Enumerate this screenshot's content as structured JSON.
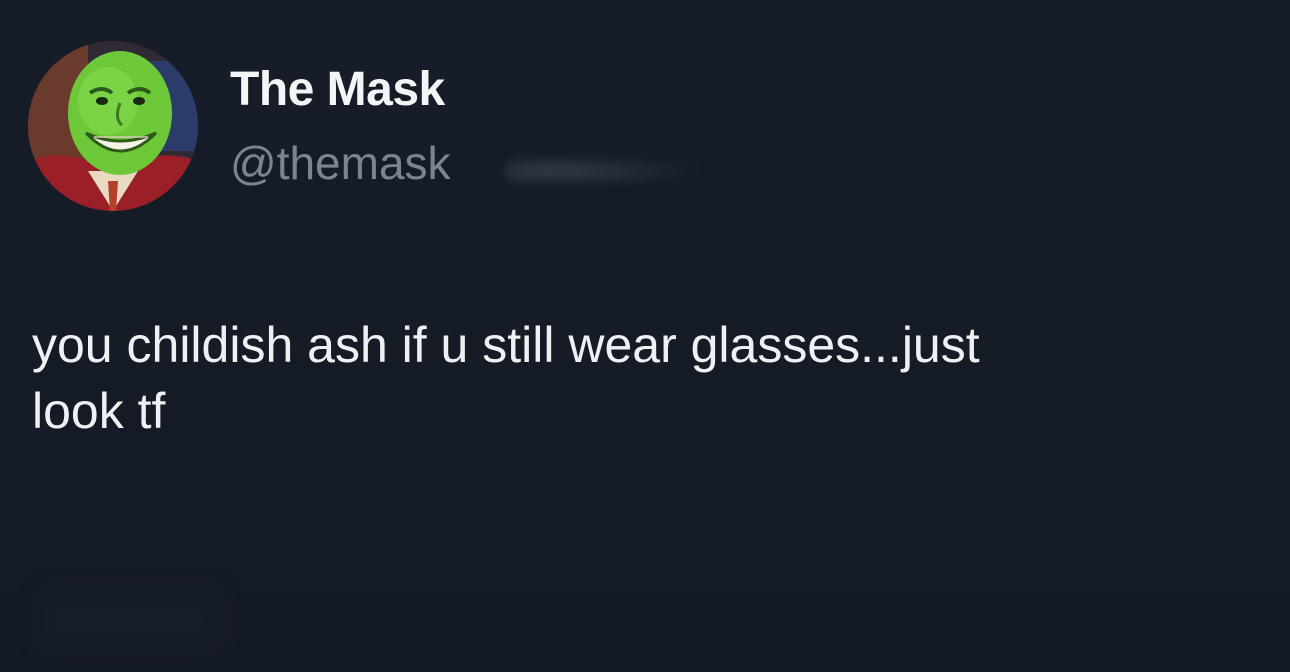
{
  "tweet": {
    "author": {
      "display_name": "The Mask",
      "handle": "@themask",
      "avatar_icon": "green-mask-face-avatar"
    },
    "text": "you childish ash if u still wear glasses...just\nlook tf"
  },
  "colors": {
    "background": "#151b26",
    "primary_text": "#eef1f4",
    "secondary_text": "#7b8590"
  }
}
